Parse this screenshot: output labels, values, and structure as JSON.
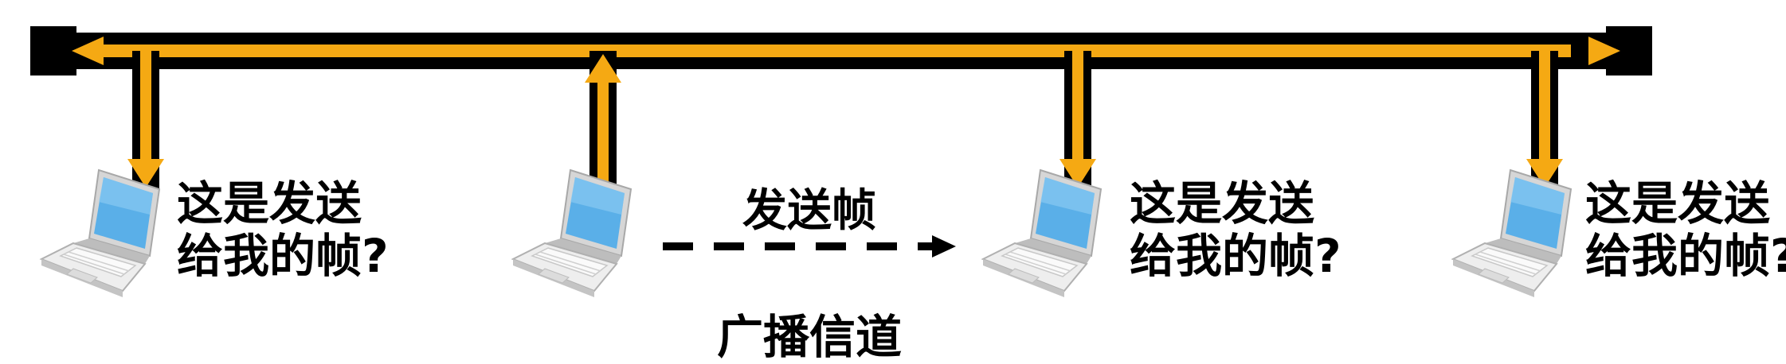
{
  "colors": {
    "bus_outline": "#000000",
    "bus_arrow": "#F5A913",
    "screen": "#5AAFE8",
    "laptop_body": "#E4E4E4",
    "text": "#000000"
  },
  "stations": [
    {
      "id": "station-1",
      "question_line1": "这是发送",
      "question_line2": "给我的帧?",
      "arrow": "down"
    },
    {
      "id": "station-2",
      "question_line1": "",
      "question_line2": "",
      "arrow": "up"
    },
    {
      "id": "station-3",
      "question_line1": "这是发送",
      "question_line2": "给我的帧?",
      "arrow": "down"
    },
    {
      "id": "station-4",
      "question_line1": "这是发送",
      "question_line2": "给我的帧?",
      "arrow": "down"
    }
  ],
  "frame_label": "发送帧",
  "channel_label": "广播信道"
}
